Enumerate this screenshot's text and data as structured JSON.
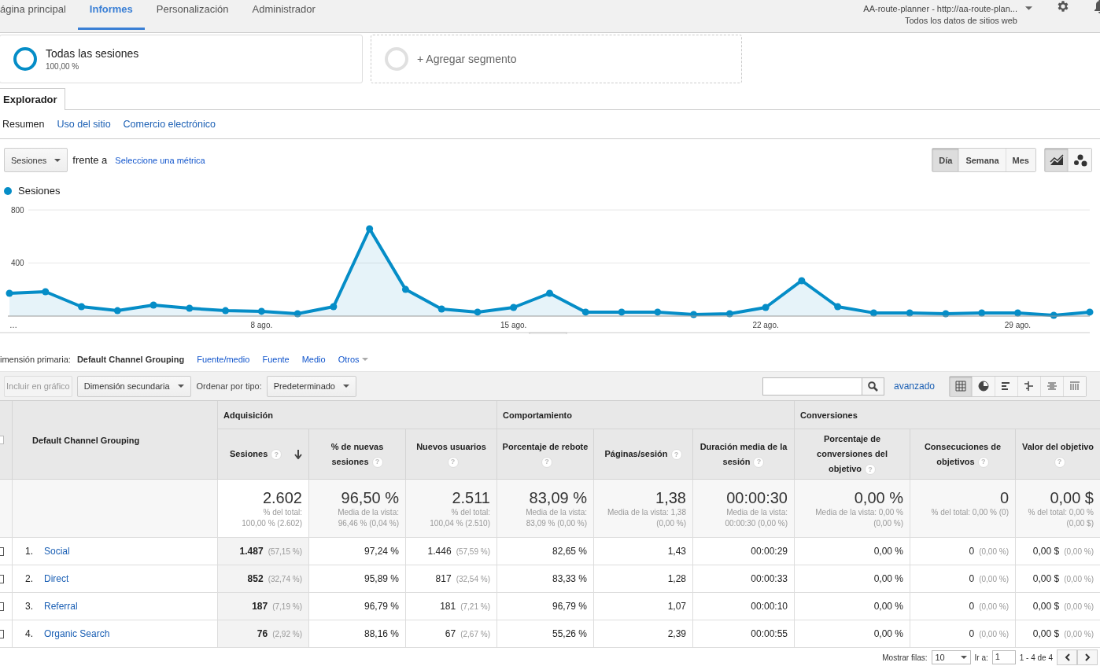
{
  "nav": {
    "tabs": [
      {
        "label": "ágina principal",
        "selected": false
      },
      {
        "label": "Informes",
        "selected": true
      },
      {
        "label": "Personalización",
        "selected": false
      },
      {
        "label": "Administrador",
        "selected": false
      }
    ],
    "account": {
      "property": "AA-route-planner - http://aa-route-plan...",
      "view": "Todos los datos de sitios web"
    }
  },
  "segments": [
    {
      "kind": "active",
      "title": "Todas las sesiones",
      "share": "100,00 %"
    },
    {
      "kind": "add",
      "title": "+ Agregar segmento"
    }
  ],
  "report_tabs": [
    {
      "label": "Explorador",
      "selected": true
    }
  ],
  "subtabs": [
    {
      "label": "Resumen",
      "selected": true
    },
    {
      "label": "Uso del sitio",
      "selected": false
    },
    {
      "label": "Comercio electrónico",
      "selected": false
    }
  ],
  "chart_controls": {
    "metric": "Sesiones",
    "versus": "frente a",
    "compare_link": "Seleccione una métrica",
    "periods": [
      {
        "label": "Día",
        "selected": true
      },
      {
        "label": "Semana",
        "selected": false
      },
      {
        "label": "Mes",
        "selected": false
      }
    ],
    "chart_types": [
      {
        "kind": "line",
        "selected": true
      },
      {
        "kind": "motion",
        "selected": false
      }
    ]
  },
  "chart": {
    "chart_data": {
      "type": "area",
      "categories": [
        "…",
        null,
        null,
        null,
        null,
        null,
        null,
        "8 ago.",
        null,
        null,
        null,
        null,
        null,
        null,
        "15 ago.",
        null,
        null,
        null,
        null,
        null,
        null,
        "22 ago.",
        null,
        null,
        null,
        null,
        null,
        null,
        "29 ago.",
        null,
        null
      ],
      "series": [
        {
          "name": "Sesiones",
          "color": "#058dc7",
          "values": [
            172,
            184,
            71,
            41,
            83,
            59,
            41,
            36,
            18,
            71,
            658,
            201,
            53,
            30,
            65,
            172,
            30,
            30,
            30,
            12,
            18,
            65,
            267,
            71,
            24,
            24,
            18,
            24,
            24,
            6,
            30
          ]
        }
      ],
      "ylim": [
        0,
        800
      ],
      "yticks": [
        {
          "value": 400,
          "label": "400"
        },
        {
          "value": 800,
          "label": "800"
        }
      ]
    }
  },
  "dimensions": {
    "label": "imensión primaria:",
    "items": [
      {
        "kind": "link",
        "label": "Default Channel Grouping",
        "selected": true
      },
      {
        "kind": "link",
        "label": "Fuente/medio",
        "selected": false
      },
      {
        "kind": "link",
        "label": "Fuente",
        "selected": false
      },
      {
        "kind": "link",
        "label": "Medio",
        "selected": false
      },
      {
        "kind": "menu",
        "label": "Otros",
        "selected": false
      }
    ]
  },
  "toolbar": {
    "plot_button": {
      "label": "Incluir en gráfico",
      "disabled": true
    },
    "secondary_dimension": "Dimensión secundaria",
    "sort_label": "Ordenar por tipo:",
    "sort_value": "Predeterminado",
    "advanced_link": "avanzado",
    "views": [
      {
        "kind": "table",
        "selected": true
      },
      {
        "kind": "pie",
        "selected": false
      },
      {
        "kind": "performance",
        "selected": false
      },
      {
        "kind": "comparison",
        "selected": false
      },
      {
        "kind": "pivot",
        "selected": false
      },
      {
        "kind": "cloud",
        "selected": false
      }
    ]
  },
  "table": {
    "select_all": {
      "checked": false
    },
    "name_column": "Default Channel Grouping",
    "groups": [
      {
        "label": "Adquisición",
        "columns": [
          {
            "label": "Sesiones",
            "help": "?",
            "sorted": true
          },
          {
            "label": "% de nuevas sesiones",
            "help": "?",
            "sorted": false
          },
          {
            "label": "Nuevos usuarios",
            "help": "?",
            "sorted": false
          }
        ]
      },
      {
        "label": "Comportamiento",
        "columns": [
          {
            "label": "Porcentaje de rebote",
            "help": "?",
            "sorted": false
          },
          {
            "label": "Páginas/sesión",
            "help": "?",
            "sorted": false
          },
          {
            "label": "Duración media de la sesión",
            "help": "?",
            "sorted": false
          }
        ]
      },
      {
        "label": "Conversiones",
        "columns": [
          {
            "label": "Porcentaje de conversiones del objetivo",
            "help": "?",
            "sorted": false
          },
          {
            "label": "Consecuciones de objetivos",
            "help": "?",
            "sorted": false
          },
          {
            "label": "Valor del objetivo",
            "help": "?",
            "sorted": false
          }
        ]
      }
    ],
    "totals": [
      {
        "value": "2.602",
        "notes": [
          "% del total:",
          "100,00 % (2.602)"
        ]
      },
      {
        "value": "96,50 %",
        "notes": [
          "Media de la vista:",
          "96,46 % (0,04 %)"
        ]
      },
      {
        "value": "2.511",
        "notes": [
          "% del total:",
          "100,04 % (2.510)"
        ]
      },
      {
        "value": "83,09 %",
        "notes": [
          "Media de la vista:",
          "83,09 % (0,00 %)"
        ]
      },
      {
        "value": "1,38",
        "notes": [
          "Media de la vista: 1,38",
          "(0,00 %)"
        ]
      },
      {
        "value": "00:00:30",
        "notes": [
          "Media de la vista:",
          "00:00:30 (0,00 %)"
        ]
      },
      {
        "value": "0,00 %",
        "notes": [
          "Media de la vista: 0,00 %",
          "(0,00 %)"
        ]
      },
      {
        "value": "0",
        "notes": [
          "% del total: 0,00 % (0)"
        ]
      },
      {
        "value": "0,00 $",
        "notes": [
          "% del total: 0,00 %",
          "(0,00 $)"
        ]
      }
    ],
    "rows": [
      {
        "index": "1.",
        "name": "Social",
        "checked": false,
        "cells": [
          {
            "value": "1.487",
            "share": "(57,15 %)"
          },
          {
            "value": "97,24 %"
          },
          {
            "value": "1.446",
            "share": "(57,59 %)"
          },
          {
            "value": "82,65 %"
          },
          {
            "value": "1,43"
          },
          {
            "value": "00:00:29"
          },
          {
            "value": "0,00 %"
          },
          {
            "value": "0",
            "share": "(0,00 %)"
          },
          {
            "value": "0,00 $",
            "share": "(0,00 %)"
          }
        ]
      },
      {
        "index": "2.",
        "name": "Direct",
        "checked": false,
        "cells": [
          {
            "value": "852",
            "share": "(32,74 %)"
          },
          {
            "value": "95,89 %"
          },
          {
            "value": "817",
            "share": "(32,54 %)"
          },
          {
            "value": "83,33 %"
          },
          {
            "value": "1,28"
          },
          {
            "value": "00:00:33"
          },
          {
            "value": "0,00 %"
          },
          {
            "value": "0",
            "share": "(0,00 %)"
          },
          {
            "value": "0,00 $",
            "share": "(0,00 %)"
          }
        ]
      },
      {
        "index": "3.",
        "name": "Referral",
        "checked": false,
        "cells": [
          {
            "value": "187",
            "share": "(7,19 %)"
          },
          {
            "value": "96,79 %"
          },
          {
            "value": "181",
            "share": "(7,21 %)"
          },
          {
            "value": "96,79 %"
          },
          {
            "value": "1,07"
          },
          {
            "value": "00:00:10"
          },
          {
            "value": "0,00 %"
          },
          {
            "value": "0",
            "share": "(0,00 %)"
          },
          {
            "value": "0,00 $",
            "share": "(0,00 %)"
          }
        ]
      },
      {
        "index": "4.",
        "name": "Organic Search",
        "checked": false,
        "cells": [
          {
            "value": "76",
            "share": "(2,92 %)"
          },
          {
            "value": "88,16 %"
          },
          {
            "value": "67",
            "share": "(2,67 %)"
          },
          {
            "value": "55,26 %"
          },
          {
            "value": "2,39"
          },
          {
            "value": "00:00:55"
          },
          {
            "value": "0,00 %"
          },
          {
            "value": "0",
            "share": "(0,00 %)"
          },
          {
            "value": "0,00 $",
            "share": "(0,00 %)"
          }
        ]
      }
    ]
  },
  "pager": {
    "rows_label": "Mostrar filas:",
    "rows_value": "10",
    "goto_label": "Ir a:",
    "goto_value": "1",
    "range": "1 - 4 de 4"
  }
}
